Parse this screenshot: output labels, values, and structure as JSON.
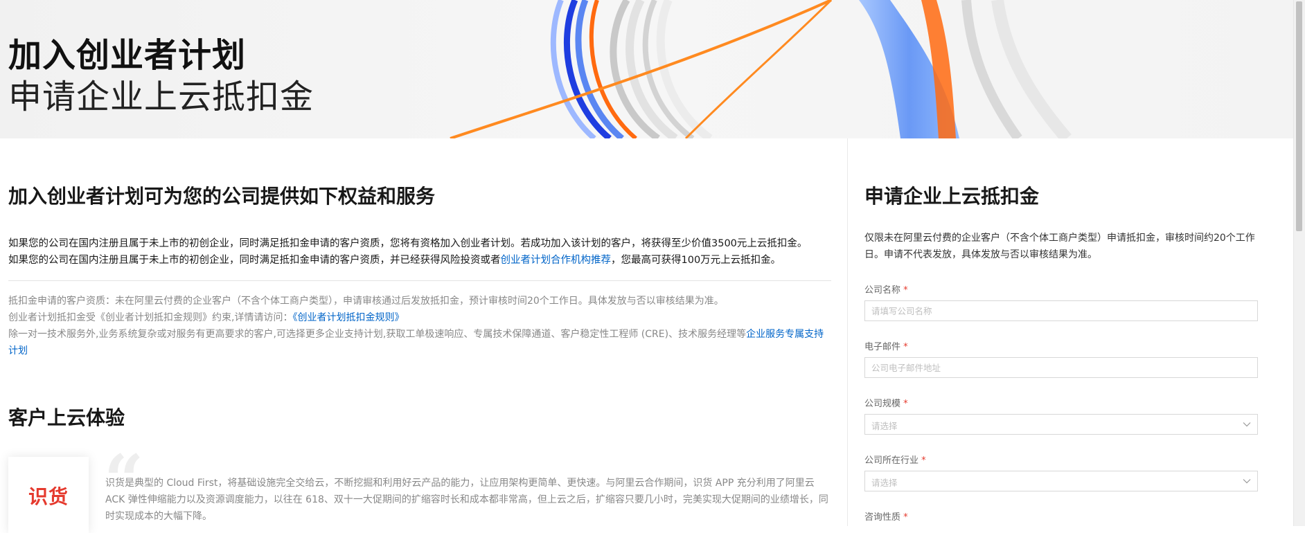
{
  "hero": {
    "title": "加入创业者计划",
    "subtitle": "申请企业上云抵扣金"
  },
  "left": {
    "benefits_title": "加入创业者计划可为您的公司提供如下权益和服务",
    "lead_1": "如果您的公司在国内注册且属于未上市的初创企业，同时满足抵扣金申请的客户资质，您将有资格加入创业者计划。若成功加入该计划的客户，将获得至少价值3500元上云抵扣金。",
    "lead_2_before": "如果您的公司在国内注册且属于未上市的初创企业，同时满足抵扣金申请的客户资质，并已经获得风险投资或者",
    "lead_2_link": "创业者计划合作机构推荐",
    "lead_2_after": "，您最高可获得100万元上云抵扣金。",
    "note_1": "抵扣金申请的客户资质：未在阿里云付费的企业客户（不含个体工商户类型），申请审核通过后发放抵扣金，预计审核时间20个工作日。具体发放与否以审核结果为准。",
    "note_2_before": "创业者计划抵扣金受《创业者计划抵扣金规则》约束,详情请访问：",
    "note_2_link": "《创业者计划抵扣金规则》",
    "note_3_before": "除一对一技术服务外,业务系统复杂或对服务有更高要求的客户,可选择更多企业支持计划,获取工单极速响应、专属技术保障通道、客户稳定性工程师 (CRE)、技术服务经理等",
    "note_3_link": "企业服务专属支持计划",
    "experience_title": "客户上云体验",
    "case_logo": "识货",
    "case_text": "识货是典型的 Cloud First，将基础设施完全交给云，不断挖掘和利用好云产品的能力，让应用架构更简单、更快速。与阿里云合作期间，识货 APP 充分利用了阿里云 ACK 弹性伸缩能力以及资源调度能力，以往在 618、双十一大促期间的扩缩容时长和成本都非常高，但上云之后，扩缩容只要几小时，完美实现大促期间的业绩增长，同时实现成本的大幅下降。"
  },
  "form": {
    "title": "申请企业上云抵扣金",
    "intro": "仅限未在阿里云付费的企业客户（不含个体工商户类型）申请抵扣金，审核时间约20个工作日。申请不代表发放，具体发放与否以审核结果为准。",
    "required_mark": "*",
    "company_name_label": "公司名称",
    "company_name_placeholder": "请填写公司名称",
    "email_label": "电子邮件",
    "email_placeholder": "公司电子邮件地址",
    "scale_label": "公司规模",
    "scale_value": "请选择",
    "industry_label": "公司所在行业",
    "industry_value": "请选择",
    "consult_label": "咨询性质"
  },
  "colors": {
    "link": "#0064c8",
    "required": "#e53a2e",
    "logo": "#e53a2e",
    "accent_orange": "#ff7a1a",
    "accent_blue": "#3a6cf0"
  }
}
